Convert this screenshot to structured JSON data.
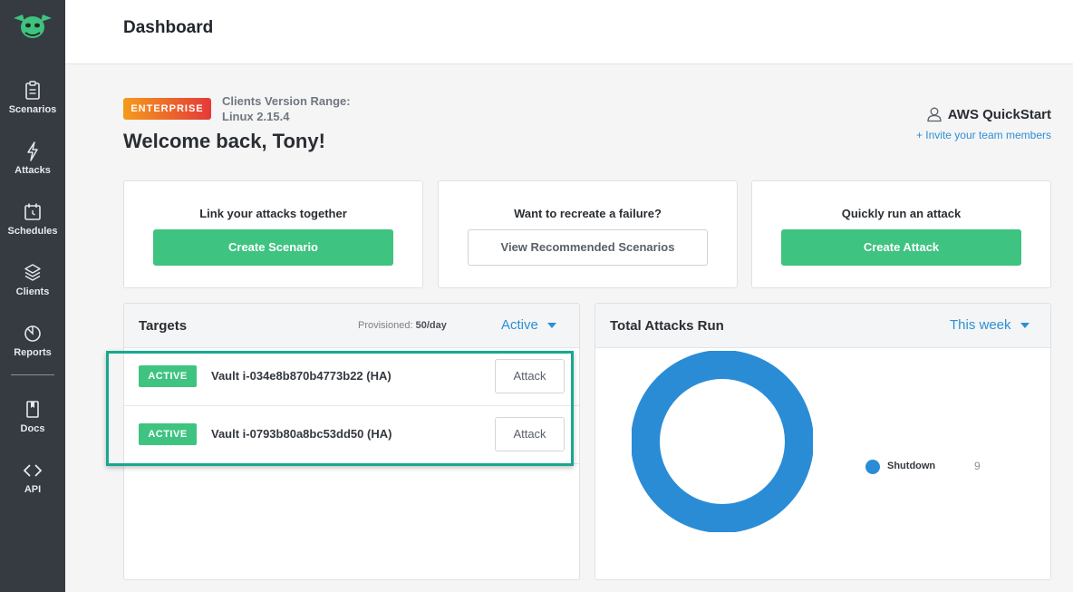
{
  "header": {
    "title": "Dashboard"
  },
  "sidebar": {
    "items": [
      {
        "label": "Scenarios",
        "icon": "clipboard-icon"
      },
      {
        "label": "Attacks",
        "icon": "lightning-icon"
      },
      {
        "label": "Schedules",
        "icon": "calendar-icon"
      },
      {
        "label": "Clients",
        "icon": "layers-icon"
      },
      {
        "label": "Reports",
        "icon": "pie-chart-icon"
      },
      {
        "label": "Docs",
        "icon": "book-icon"
      },
      {
        "label": "API",
        "icon": "code-icon"
      }
    ]
  },
  "welcome": {
    "badge": "ENTERPRISE",
    "version_label": "Clients Version Range:",
    "version_value": "Linux 2.15.4",
    "greeting": "Welcome back, Tony!",
    "team": "AWS QuickStart",
    "invite": "+ Invite your team members"
  },
  "actions": [
    {
      "heading": "Link your attacks together",
      "button": "Create Scenario"
    },
    {
      "heading": "Want to recreate a failure?",
      "button": "View Recommended Scenarios"
    },
    {
      "heading": "Quickly run an attack",
      "button": "Create Attack"
    }
  ],
  "targets": {
    "title": "Targets",
    "provisioned_label": "Provisioned:",
    "provisioned_value": "50/day",
    "filter": "Active",
    "rows": [
      {
        "status": "ACTIVE",
        "name": "Vault i-034e8b870b4773b22 (HA)",
        "button": "Attack"
      },
      {
        "status": "ACTIVE",
        "name": "Vault i-0793b80a8bc53dd50 (HA)",
        "button": "Attack"
      }
    ]
  },
  "attacks_run": {
    "title": "Total Attacks Run",
    "filter": "This week",
    "legend": [
      {
        "label": "Shutdown",
        "value": "9",
        "color": "#2b8cd6"
      }
    ]
  },
  "colors": {
    "sidebar": "#363a41",
    "accent_green": "#3fc380",
    "link_blue": "#2d8fd5",
    "highlight": "#17a88f"
  }
}
